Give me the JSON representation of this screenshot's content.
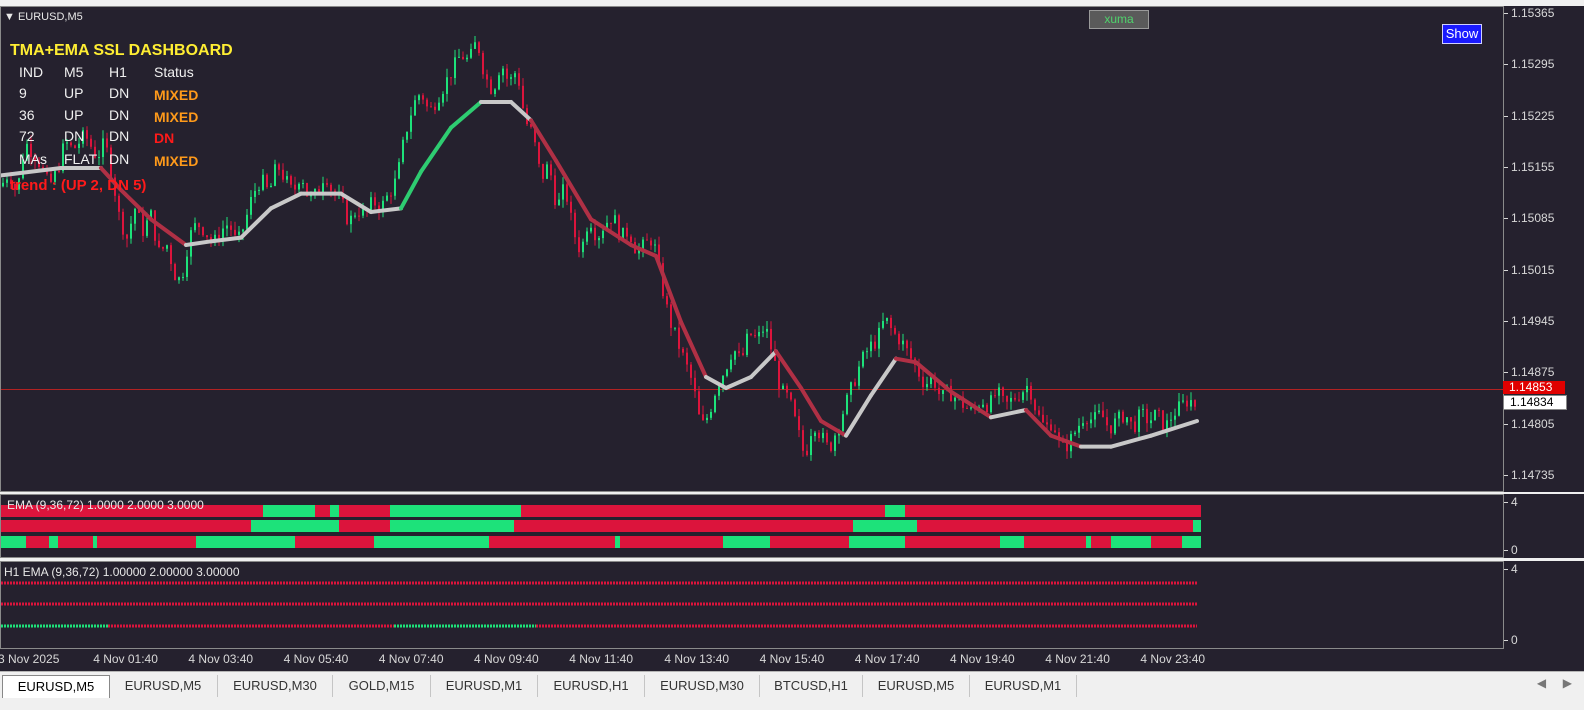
{
  "chart_window": {
    "symbol_title": "EURUSD,M5",
    "xuma_label": "xuma",
    "show_button": "Show"
  },
  "dashboard": {
    "title": "TMA+EMA SSL DASHBOARD",
    "headers": [
      "IND",
      "M5",
      "H1",
      "Status"
    ],
    "rows": [
      {
        "ind": "9",
        "m5": "UP",
        "h1": "DN",
        "status": "MIXED",
        "status_color": "#ff9a1a"
      },
      {
        "ind": "36",
        "m5": "UP",
        "h1": "DN",
        "status": "MIXED",
        "status_color": "#ff9a1a"
      },
      {
        "ind": "72",
        "m5": "DN",
        "h1": "DN",
        "status": "DN",
        "status_color": "#ff1a1a"
      },
      {
        "ind": "MAs",
        "m5": "FLAT",
        "h1": "DN",
        "status": "MIXED",
        "status_color": "#ff9a1a"
      }
    ],
    "trend": "trend : (UP 2, DN 5)"
  },
  "price_axis": {
    "labels": [
      "1.15365",
      "1.15295",
      "1.15225",
      "1.15155",
      "1.15085",
      "1.15015",
      "1.14945",
      "1.14875",
      "1.14805",
      "1.14735"
    ],
    "current_price_red": "1.14853",
    "current_price_white": "1.14834"
  },
  "ema_panel": {
    "title": "EMA (9,36,72) 1.0000 2.0000 3.0000",
    "scale_top": "4",
    "scale_bottom": "0"
  },
  "h1_panel": {
    "title": "H1 EMA (9,36,72) 1.00000 2.00000 3.00000",
    "scale_top": "4",
    "scale_bottom": "0"
  },
  "time_axis": {
    "labels": [
      "3 Nov 2025",
      "4 Nov 01:40",
      "4 Nov 03:40",
      "4 Nov 05:40",
      "4 Nov 07:40",
      "4 Nov 09:40",
      "4 Nov 11:40",
      "4 Nov 13:40",
      "4 Nov 15:40",
      "4 Nov 17:40",
      "4 Nov 19:40",
      "4 Nov 21:40",
      "4 Nov 23:40"
    ]
  },
  "tabs": [
    {
      "label": "EURUSD,M5",
      "active": true
    },
    {
      "label": "EURUSD,M5",
      "active": false
    },
    {
      "label": "EURUSD,M30",
      "active": false
    },
    {
      "label": "GOLD,M15",
      "active": false
    },
    {
      "label": "EURUSD,M1",
      "active": false
    },
    {
      "label": "EURUSD,H1",
      "active": false
    },
    {
      "label": "EURUSD,M30",
      "active": false
    },
    {
      "label": "BTCUSD,H1",
      "active": false
    },
    {
      "label": "EURUSD,M5",
      "active": false
    },
    {
      "label": "EURUSD,M1",
      "active": false
    }
  ],
  "colors": {
    "background": "#25212e",
    "bull": "#1de27a",
    "bear": "#dc143c",
    "ma_up": "#2ecc71",
    "ma_down": "#b03045",
    "ma_flat": "#c8c8c8"
  },
  "chart_data": {
    "type": "candlestick",
    "ylim": [
      1.147,
      1.1538
    ],
    "price_path": [
      [
        0,
        1.1513
      ],
      [
        8,
        1.1515
      ],
      [
        16,
        1.1512
      ],
      [
        24,
        1.1519
      ],
      [
        36,
        1.1517
      ],
      [
        48,
        1.1513
      ],
      [
        56,
        1.1515
      ],
      [
        64,
        1.1519
      ],
      [
        72,
        1.1518
      ],
      [
        84,
        1.152
      ],
      [
        96,
        1.1517
      ],
      [
        104,
        1.1519
      ],
      [
        112,
        1.1514
      ],
      [
        118,
        1.1509
      ],
      [
        126,
        1.1506
      ],
      [
        134,
        1.151
      ],
      [
        142,
        1.1507
      ],
      [
        150,
        1.1509
      ],
      [
        158,
        1.1504
      ],
      [
        166,
        1.1505
      ],
      [
        174,
        1.1501
      ],
      [
        180,
        1.15
      ],
      [
        188,
        1.1506
      ],
      [
        196,
        1.1508
      ],
      [
        204,
        1.1507
      ],
      [
        212,
        1.1505
      ],
      [
        220,
        1.1507
      ],
      [
        228,
        1.1508
      ],
      [
        236,
        1.1505
      ],
      [
        244,
        1.1508
      ],
      [
        252,
        1.1512
      ],
      [
        260,
        1.1514
      ],
      [
        268,
        1.1512
      ],
      [
        276,
        1.1516
      ],
      [
        284,
        1.1514
      ],
      [
        292,
        1.1512
      ],
      [
        300,
        1.1515
      ],
      [
        308,
        1.1511
      ],
      [
        316,
        1.1512
      ],
      [
        324,
        1.1515
      ],
      [
        332,
        1.1512
      ],
      [
        340,
        1.1511
      ],
      [
        348,
        1.1508
      ],
      [
        356,
        1.151
      ],
      [
        364,
        1.1509
      ],
      [
        372,
        1.1511
      ],
      [
        380,
        1.151
      ],
      [
        388,
        1.1512
      ],
      [
        396,
        1.1514
      ],
      [
        404,
        1.152
      ],
      [
        412,
        1.1524
      ],
      [
        420,
        1.1526
      ],
      [
        428,
        1.1523
      ],
      [
        436,
        1.1525
      ],
      [
        444,
        1.1527
      ],
      [
        452,
        1.1529
      ],
      [
        460,
        1.1531
      ],
      [
        468,
        1.153
      ],
      [
        476,
        1.1533
      ],
      [
        484,
        1.1528
      ],
      [
        492,
        1.1526
      ],
      [
        500,
        1.153
      ],
      [
        508,
        1.1527
      ],
      [
        516,
        1.1529
      ],
      [
        524,
        1.1522
      ],
      [
        532,
        1.152
      ],
      [
        540,
        1.1514
      ],
      [
        548,
        1.1516
      ],
      [
        556,
        1.151
      ],
      [
        564,
        1.1513
      ],
      [
        572,
        1.1507
      ],
      [
        580,
        1.1504
      ],
      [
        588,
        1.1509
      ],
      [
        596,
        1.1506
      ],
      [
        604,
        1.1508
      ],
      [
        612,
        1.1509
      ],
      [
        620,
        1.1506
      ],
      [
        628,
        1.1507
      ],
      [
        636,
        1.1504
      ],
      [
        644,
        1.1505
      ],
      [
        652,
        1.1506
      ],
      [
        660,
        1.15
      ],
      [
        668,
        1.1495
      ],
      [
        676,
        1.1492
      ],
      [
        684,
        1.1489
      ],
      [
        692,
        1.1486
      ],
      [
        700,
        1.148
      ],
      [
        708,
        1.1482
      ],
      [
        716,
        1.1486
      ],
      [
        724,
        1.1488
      ],
      [
        732,
        1.1491
      ],
      [
        740,
        1.1489
      ],
      [
        748,
        1.1493
      ],
      [
        756,
        1.1492
      ],
      [
        764,
        1.1494
      ],
      [
        772,
        1.149
      ],
      [
        780,
        1.1485
      ],
      [
        788,
        1.1484
      ],
      [
        796,
        1.148
      ],
      [
        804,
        1.1476
      ],
      [
        812,
        1.1481
      ],
      [
        820,
        1.1479
      ],
      [
        828,
        1.1477
      ],
      [
        836,
        1.148
      ],
      [
        844,
        1.1483
      ],
      [
        852,
        1.1486
      ],
      [
        860,
        1.1489
      ],
      [
        868,
        1.1491
      ],
      [
        876,
        1.1492
      ],
      [
        884,
        1.1495
      ],
      [
        892,
        1.1493
      ],
      [
        900,
        1.1492
      ],
      [
        908,
        1.149
      ],
      [
        916,
        1.1488
      ],
      [
        924,
        1.1486
      ],
      [
        932,
        1.1487
      ],
      [
        940,
        1.1484
      ],
      [
        948,
        1.1485
      ],
      [
        956,
        1.1484
      ],
      [
        964,
        1.1483
      ],
      [
        972,
        1.1482
      ],
      [
        980,
        1.1484
      ],
      [
        988,
        1.1483
      ],
      [
        996,
        1.1485
      ],
      [
        1004,
        1.1483
      ],
      [
        1012,
        1.1484
      ],
      [
        1020,
        1.1485
      ],
      [
        1028,
        1.1486
      ],
      [
        1036,
        1.1482
      ],
      [
        1044,
        1.148
      ],
      [
        1052,
        1.1481
      ],
      [
        1060,
        1.1477
      ],
      [
        1068,
        1.1478
      ],
      [
        1076,
        1.148
      ],
      [
        1084,
        1.1482
      ],
      [
        1092,
        1.1481
      ],
      [
        1100,
        1.1482
      ],
      [
        1108,
        1.148
      ],
      [
        1116,
        1.1481
      ],
      [
        1124,
        1.1482
      ],
      [
        1132,
        1.148
      ],
      [
        1140,
        1.1482
      ],
      [
        1148,
        1.1481
      ],
      [
        1156,
        1.1482
      ],
      [
        1164,
        1.148
      ],
      [
        1172,
        1.1482
      ],
      [
        1180,
        1.1483
      ],
      [
        1188,
        1.1484
      ],
      [
        1196,
        1.1483
      ]
    ],
    "ma_path": [
      {
        "x": 0,
        "y": 1.15145,
        "c": "flat"
      },
      {
        "x": 60,
        "y": 1.15155,
        "c": "flat"
      },
      {
        "x": 100,
        "y": 1.15155,
        "c": "flat"
      },
      {
        "x": 120,
        "y": 1.15125,
        "c": "down"
      },
      {
        "x": 150,
        "y": 1.15085,
        "c": "down"
      },
      {
        "x": 185,
        "y": 1.1505,
        "c": "down"
      },
      {
        "x": 210,
        "y": 1.15055,
        "c": "flat"
      },
      {
        "x": 240,
        "y": 1.1506,
        "c": "flat"
      },
      {
        "x": 270,
        "y": 1.151,
        "c": "flat"
      },
      {
        "x": 300,
        "y": 1.1512,
        "c": "flat"
      },
      {
        "x": 340,
        "y": 1.1512,
        "c": "flat"
      },
      {
        "x": 370,
        "y": 1.15095,
        "c": "flat"
      },
      {
        "x": 400,
        "y": 1.151,
        "c": "flat"
      },
      {
        "x": 420,
        "y": 1.1515,
        "c": "up"
      },
      {
        "x": 450,
        "y": 1.1521,
        "c": "up"
      },
      {
        "x": 480,
        "y": 1.15245,
        "c": "up"
      },
      {
        "x": 510,
        "y": 1.15245,
        "c": "flat"
      },
      {
        "x": 530,
        "y": 1.1522,
        "c": "flat"
      },
      {
        "x": 555,
        "y": 1.15165,
        "c": "down"
      },
      {
        "x": 590,
        "y": 1.15085,
        "c": "down"
      },
      {
        "x": 630,
        "y": 1.1505,
        "c": "down"
      },
      {
        "x": 655,
        "y": 1.15035,
        "c": "down"
      },
      {
        "x": 680,
        "y": 1.14945,
        "c": "down"
      },
      {
        "x": 705,
        "y": 1.1487,
        "c": "down"
      },
      {
        "x": 725,
        "y": 1.14855,
        "c": "flat"
      },
      {
        "x": 750,
        "y": 1.1487,
        "c": "flat"
      },
      {
        "x": 775,
        "y": 1.14905,
        "c": "flat"
      },
      {
        "x": 800,
        "y": 1.14855,
        "c": "down"
      },
      {
        "x": 820,
        "y": 1.1481,
        "c": "down"
      },
      {
        "x": 845,
        "y": 1.1479,
        "c": "down"
      },
      {
        "x": 870,
        "y": 1.14845,
        "c": "flat"
      },
      {
        "x": 895,
        "y": 1.14895,
        "c": "flat"
      },
      {
        "x": 915,
        "y": 1.1489,
        "c": "down"
      },
      {
        "x": 950,
        "y": 1.1485,
        "c": "down"
      },
      {
        "x": 990,
        "y": 1.14815,
        "c": "down"
      },
      {
        "x": 1025,
        "y": 1.14825,
        "c": "flat"
      },
      {
        "x": 1050,
        "y": 1.1479,
        "c": "down"
      },
      {
        "x": 1080,
        "y": 1.14775,
        "c": "down"
      },
      {
        "x": 1110,
        "y": 1.14775,
        "c": "flat"
      },
      {
        "x": 1150,
        "y": 1.1479,
        "c": "flat"
      },
      {
        "x": 1196,
        "y": 1.1481,
        "c": "flat"
      }
    ],
    "current_price": 1.14853,
    "ema_rows": [
      [
        [
          0,
          262,
          "r"
        ],
        [
          262,
          314,
          "g"
        ],
        [
          314,
          329,
          "r"
        ],
        [
          329,
          338,
          "g"
        ],
        [
          338,
          389,
          "r"
        ],
        [
          389,
          520,
          "g"
        ],
        [
          520,
          884,
          "r"
        ],
        [
          884,
          904,
          "g"
        ],
        [
          904,
          1200,
          "r"
        ]
      ],
      [
        [
          0,
          250,
          "r"
        ],
        [
          250,
          338,
          "g"
        ],
        [
          338,
          389,
          "r"
        ],
        [
          389,
          513,
          "g"
        ],
        [
          513,
          852,
          "r"
        ],
        [
          852,
          916,
          "g"
        ],
        [
          916,
          1192,
          "r"
        ],
        [
          1192,
          1200,
          "g"
        ]
      ],
      [
        [
          0,
          25,
          "g"
        ],
        [
          25,
          48,
          "r"
        ],
        [
          48,
          57,
          "g"
        ],
        [
          57,
          92,
          "r"
        ],
        [
          92,
          96,
          "g"
        ],
        [
          96,
          195,
          "r"
        ],
        [
          195,
          294,
          "g"
        ],
        [
          294,
          373,
          "r"
        ],
        [
          373,
          488,
          "g"
        ],
        [
          488,
          614,
          "r"
        ],
        [
          614,
          619,
          "g"
        ],
        [
          619,
          722,
          "r"
        ],
        [
          722,
          769,
          "g"
        ],
        [
          769,
          848,
          "r"
        ],
        [
          848,
          904,
          "g"
        ],
        [
          904,
          999,
          "r"
        ],
        [
          999,
          1023,
          "g"
        ],
        [
          1023,
          1085,
          "r"
        ],
        [
          1085,
          1090,
          "g"
        ],
        [
          1090,
          1110,
          "r"
        ],
        [
          1110,
          1150,
          "g"
        ],
        [
          1150,
          1181,
          "r"
        ],
        [
          1181,
          1200,
          "g"
        ]
      ]
    ],
    "h1_rows": [
      [
        [
          0,
          1196,
          "r"
        ]
      ],
      [
        [
          0,
          1196,
          "r"
        ]
      ],
      [
        [
          0,
          107,
          "g"
        ],
        [
          107,
          393,
          "r"
        ],
        [
          393,
          535,
          "g"
        ],
        [
          535,
          1196,
          "r"
        ]
      ]
    ]
  }
}
